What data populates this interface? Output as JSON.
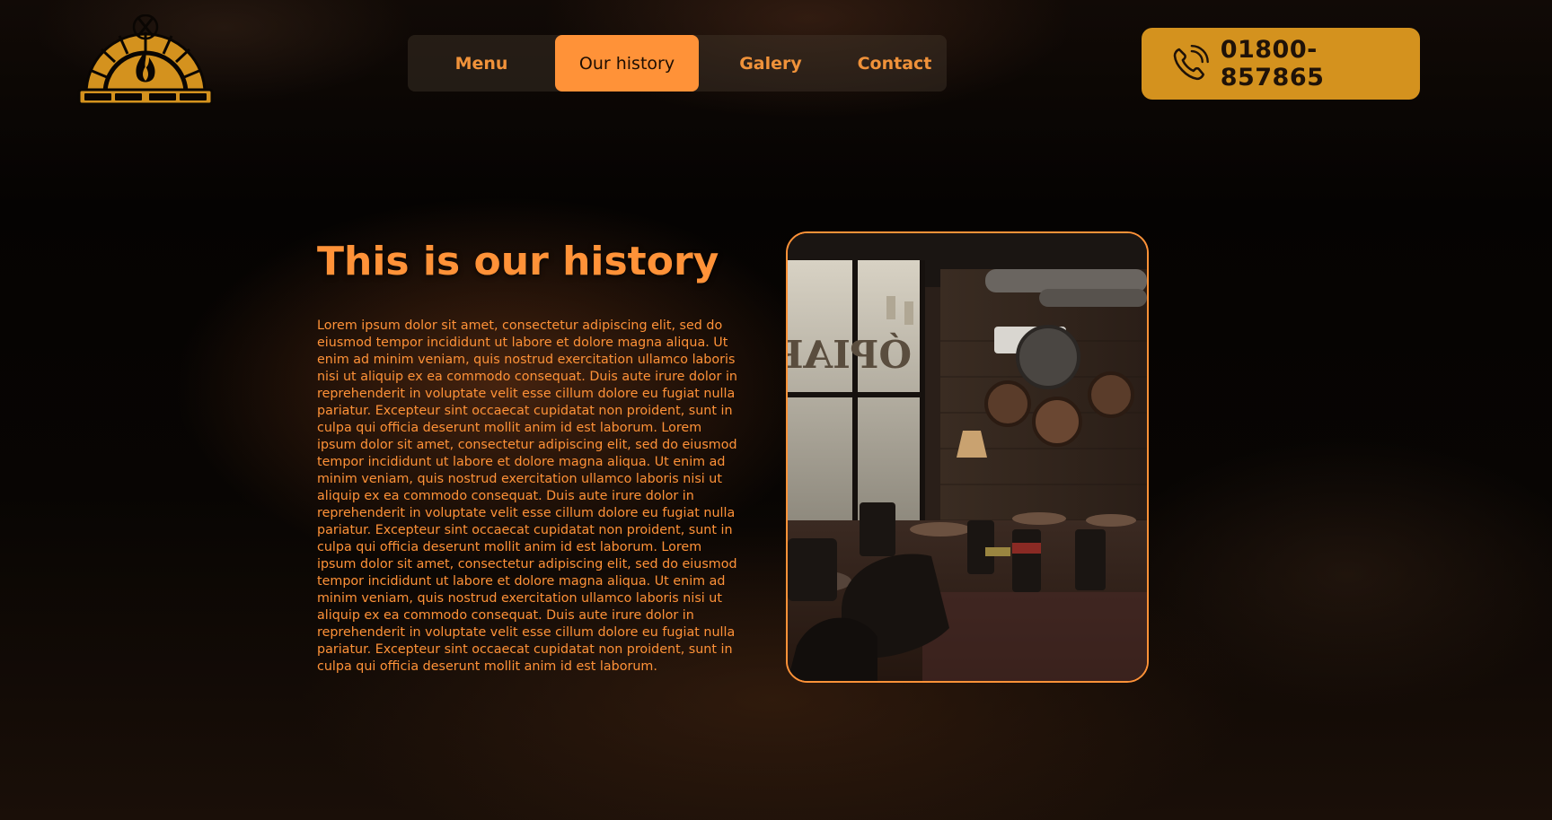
{
  "logo": {
    "icon": "wood-fired-oven-logo-icon",
    "color": "#d4921e"
  },
  "nav": {
    "items": [
      {
        "label": "Menu",
        "active": false
      },
      {
        "label": "Our history",
        "active": true
      },
      {
        "label": "Galery",
        "active": false
      },
      {
        "label": "Contact",
        "active": false
      }
    ]
  },
  "phone": {
    "icon": "phone-ringing-icon",
    "number": "01800-857865"
  },
  "history": {
    "title": "This is our history",
    "paragraph": "Lorem ipsum dolor sit amet, consectetur adipiscing elit, sed do eiusmod tempor incididunt ut labore et dolore magna aliqua. Ut enim ad minim veniam, quis nostrud exercitation ullamco laboris nisi ut aliquip ex ea commodo consequat. Duis aute irure dolor in reprehenderit in voluptate velit esse cillum dolore eu fugiat nulla pariatur. Excepteur sint occaecat cupidatat non proident, sunt in culpa qui officia deserunt mollit anim id est laborum. Lorem ipsum dolor sit amet, consectetur adipiscing elit, sed do eiusmod tempor incididunt ut labore et dolore magna aliqua. Ut enim ad minim veniam, quis nostrud exercitation ullamco laboris nisi ut aliquip ex ea commodo consequat. Duis aute irure dolor in reprehenderit in voluptate velit esse cillum dolore eu fugiat nulla pariatur. Excepteur sint occaecat cupidatat non proident, sunt in culpa qui officia deserunt mollit anim id est laborum. Lorem ipsum dolor sit amet, consectetur adipiscing elit, sed do eiusmod tempor incididunt ut labore et dolore magna aliqua. Ut enim ad minim veniam, quis nostrud exercitation ullamco laboris nisi ut aliquip ex ea commodo consequat. Duis aute irure dolor in reprehenderit in voluptate velit esse cillum dolore eu fugiat nulla pariatur. Excepteur sint occaecat cupidatat non proident, sunt in culpa qui officia deserunt mollit anim id est laborum.",
    "image": {
      "icon": "cafe-interior-photo",
      "window_sign": "ÓPIARCH"
    }
  },
  "colors": {
    "accent": "#ff9238",
    "phone_bg": "#d4921e",
    "dark_text": "#1f1208"
  }
}
